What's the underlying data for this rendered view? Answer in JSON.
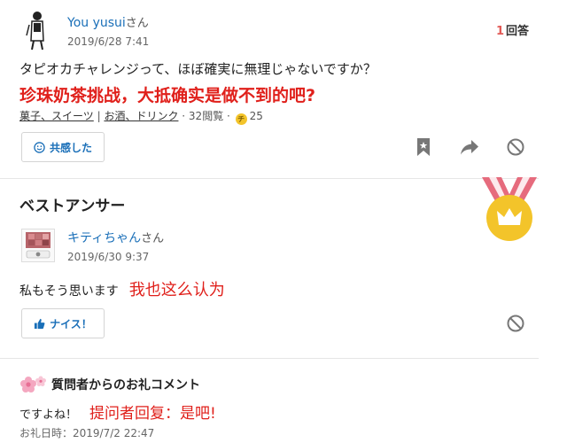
{
  "question": {
    "user_name": "You yusui",
    "user_suffix": "さん",
    "date": "2019/6/28 7:41",
    "answer_count": "1",
    "answer_count_label": "回答",
    "text": "タピオカチャレンジって、ほぼ確実に無理じゃないですか？",
    "annotation": "珍珠奶茶挑战，大抵确实是做不到的吧?",
    "tags": [
      "菓子、スイーツ",
      "お酒、ドリンク"
    ],
    "tag_separator": " | ",
    "views": "32閲覧",
    "coin_glyph": "チ",
    "coins": "25",
    "empathy_button": "共感した",
    "icons": [
      "smile-icon",
      "bookmark-icon",
      "share-icon",
      "block-icon"
    ]
  },
  "best_answer": {
    "section_title": "ベストアンサー",
    "user_name": "キティちゃん",
    "user_suffix": "さん",
    "date": "2019/6/30 9:37",
    "text": "私もそう思います",
    "annotation": "我也这么认为",
    "nice_button": "ナイス！",
    "icons": [
      "thumbs-up-icon",
      "block-icon",
      "crown-medal-icon"
    ]
  },
  "thanks_comment": {
    "title": "質問者からのお礼コメント",
    "text": "ですよね！",
    "annotation": "提问者回复：是吧!",
    "date": "お礼日時：2019/7/2 22:47",
    "icons": [
      "flower-icon"
    ]
  },
  "colors": {
    "link_blue": "#1a6fb8",
    "annotation_red": "#e0201b",
    "count_red": "#e25a56",
    "medal_gold": "#f3c42a",
    "ribbon_pink": "#e66b7d"
  }
}
